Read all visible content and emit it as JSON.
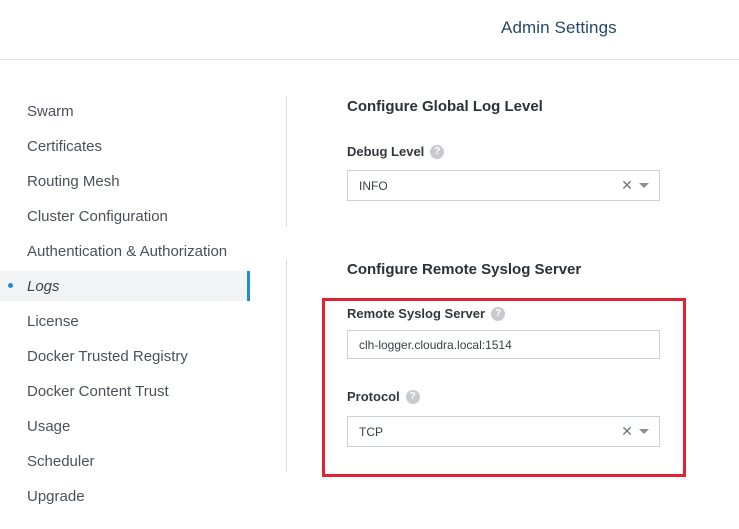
{
  "header": {
    "title": "Admin Settings"
  },
  "sidebar": {
    "items": [
      {
        "label": "Swarm"
      },
      {
        "label": "Certificates"
      },
      {
        "label": "Routing Mesh"
      },
      {
        "label": "Cluster Configuration"
      },
      {
        "label": "Authentication & Authorization"
      },
      {
        "label": "Logs",
        "active": true
      },
      {
        "label": "License"
      },
      {
        "label": "Docker Trusted Registry"
      },
      {
        "label": "Docker Content Trust"
      },
      {
        "label": "Usage"
      },
      {
        "label": "Scheduler"
      },
      {
        "label": "Upgrade"
      }
    ]
  },
  "global_log": {
    "title": "Configure Global Log Level",
    "debug_level_label": "Debug Level",
    "debug_level_value": "INFO"
  },
  "remote_syslog": {
    "title": "Configure Remote Syslog Server",
    "server_label": "Remote Syslog Server",
    "server_value": "clh-logger.cloudra.local:1514",
    "protocol_label": "Protocol",
    "protocol_value": "TCP"
  },
  "icons": {
    "help": "question-circle-icon",
    "clear": "clear-x-icon",
    "caret": "chevron-down-icon"
  },
  "colors": {
    "accent": "#1a8fd8",
    "highlight": "#e0232e",
    "header_title": "#234a68"
  }
}
